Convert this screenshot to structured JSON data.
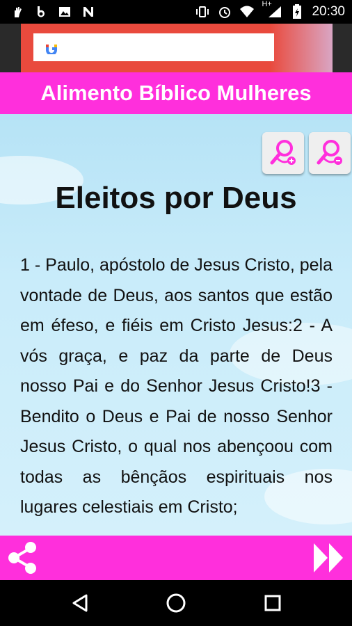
{
  "status_bar": {
    "time": "20:30",
    "network": "H+",
    "icons": [
      "hand-icon",
      "b-icon",
      "image-icon",
      "n-icon",
      "vibrate-icon",
      "alarm-icon",
      "wifi-icon",
      "signal-icon",
      "battery-icon"
    ]
  },
  "ad": {
    "brand_glyph": "G"
  },
  "app": {
    "title": "Alimento Bíblico Mulheres"
  },
  "content": {
    "chapter_title": "Eleitos por Deus",
    "verse_text": "1 - Paulo, apóstolo de Jesus Cristo, pela vontade de Deus, aos santos que estão em éfeso, e fiéis em Cristo Jesus:2 - A vós graça, e paz da parte de Deus nosso Pai e do Senhor Jesus Cristo!3 - Bendito o Deus e Pai de nosso Senhor Jesus Cristo, o qual nos abençoou com todas as bênçãos espirituais nos lugares celestiais em Cristo;"
  },
  "colors": {
    "accent": "#ff2fdc",
    "background_sky": "#c9ecfa"
  }
}
